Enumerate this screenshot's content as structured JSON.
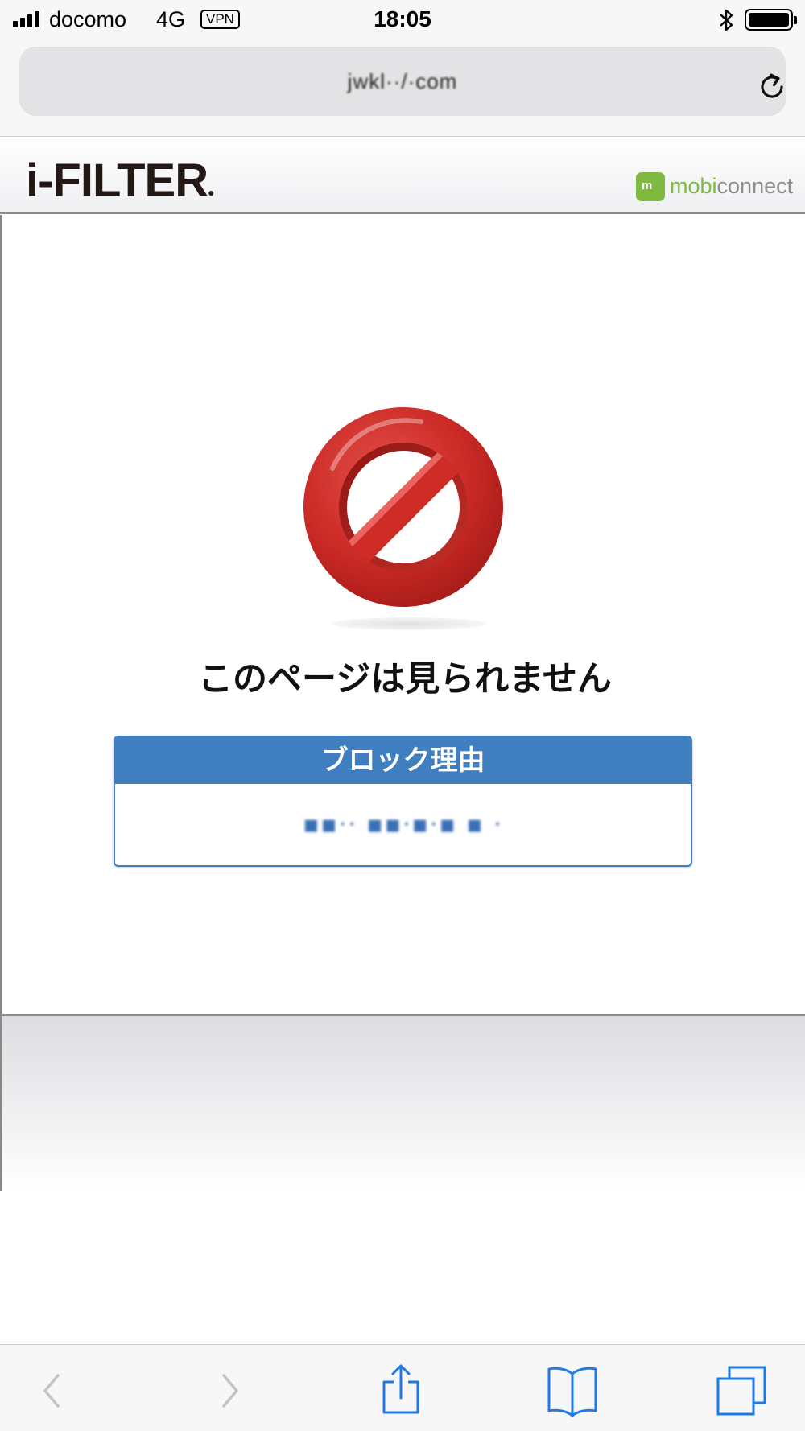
{
  "status_bar": {
    "carrier": "docomo",
    "network": "4G",
    "vpn": "VPN",
    "time": "18:05"
  },
  "browser": {
    "url": "jwkl··/·com"
  },
  "header": {
    "logo": "i-FILTER",
    "partner": {
      "prefix": "mobi",
      "suffix": "connect",
      "badge": "m"
    }
  },
  "block": {
    "title": "このページは見られません",
    "reason_label": "ブロック理由",
    "reason_value": "▪▪·· ▪▪·▪·▪ ▪ ·"
  },
  "colors": {
    "accent_blue": "#3f7fbf",
    "block_red": "#d42a2a",
    "mobi_green": "#7dba3f",
    "ios_blue": "#1f7ae6"
  },
  "icons": {
    "back": "chevron-left-icon",
    "forward": "chevron-right-icon",
    "share": "share-icon",
    "bookmarks": "book-icon",
    "tabs": "tabs-icon",
    "reload": "reload-icon"
  }
}
